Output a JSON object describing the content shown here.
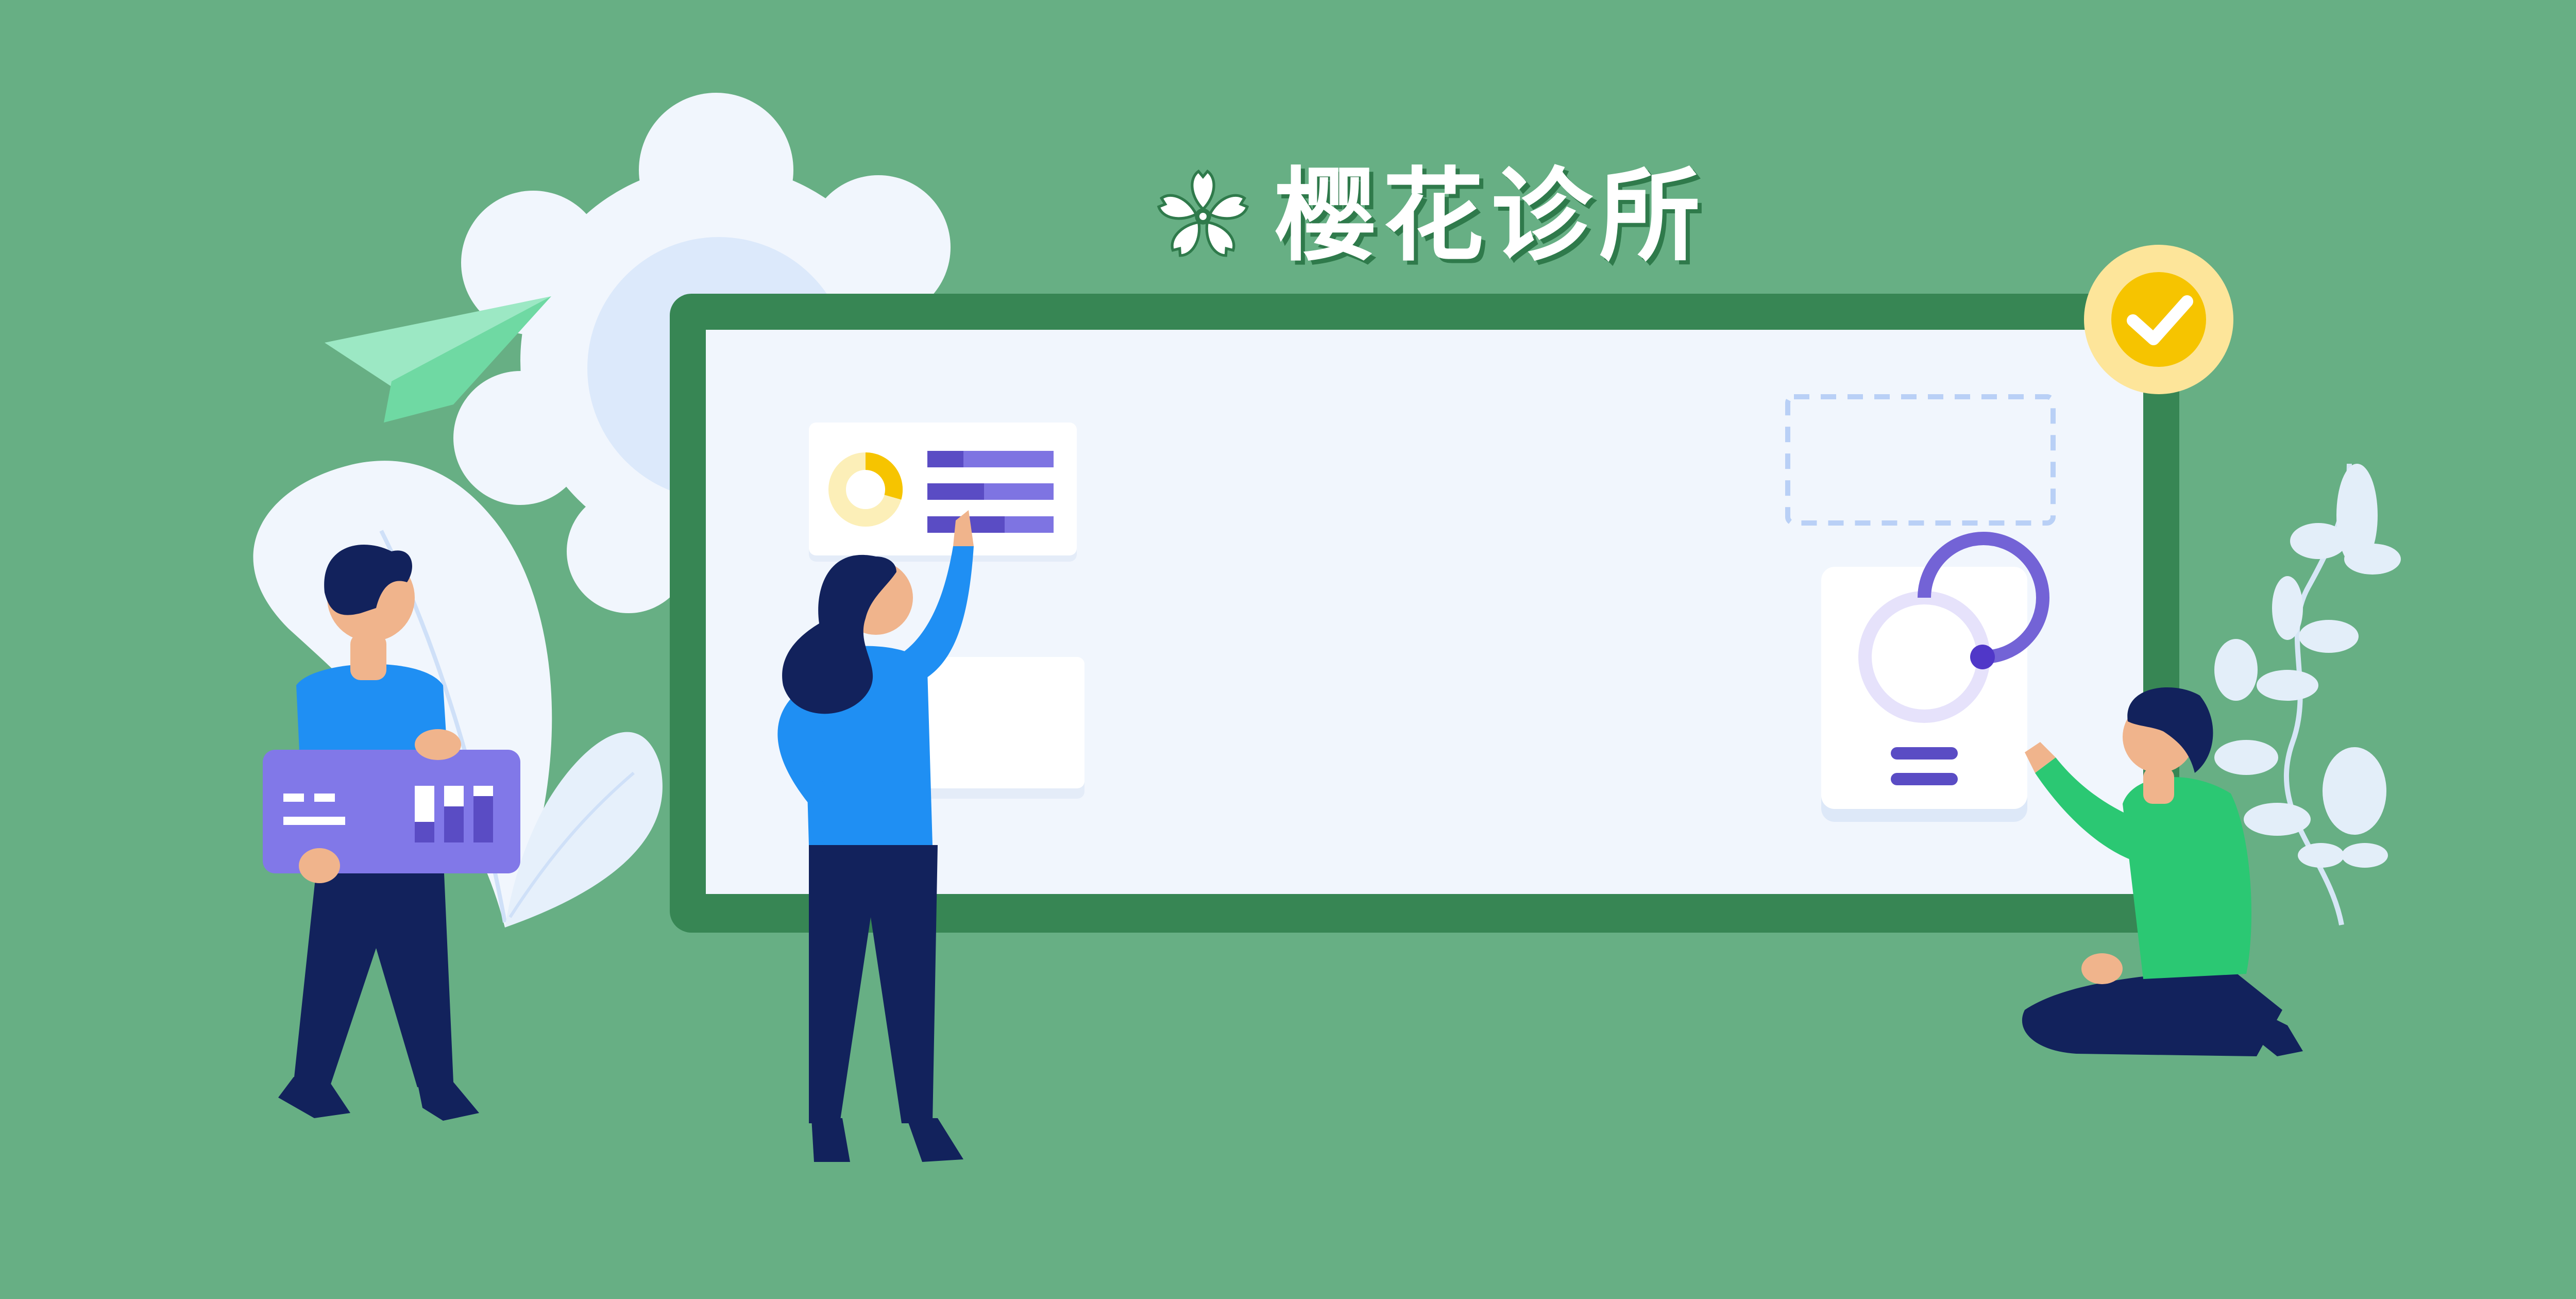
{
  "brand": {
    "name": "樱花诊所",
    "logo_icon": "sakura-flower-icon"
  },
  "colors": {
    "background": "#67af84",
    "board_frame": "#378654",
    "board_surface": "#f1f6fd",
    "accent_purple": "#7363d6",
    "accent_yellow": "#f6c400",
    "accent_blue": "#1f8ff3",
    "accent_green": "#2bc873",
    "navy": "#12225c"
  },
  "scene": {
    "icons": [
      "paper-plane-icon",
      "gear-icon",
      "check-badge-icon",
      "donut-chart-icon",
      "progress-ring-icon",
      "bar-chart-icon",
      "leaf-icon"
    ],
    "progress_ring_level": 0.85
  }
}
